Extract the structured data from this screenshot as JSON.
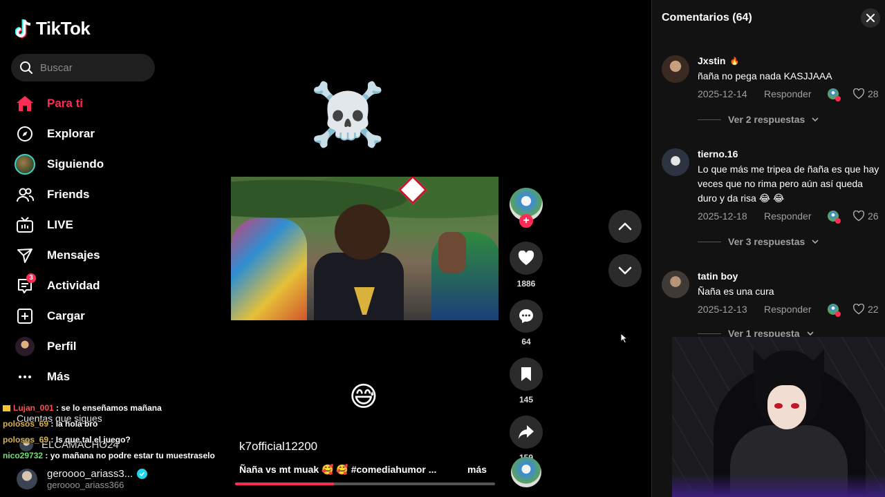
{
  "brand": {
    "name": "TikTok",
    "accent": "#fe2c55"
  },
  "search": {
    "placeholder": "Buscar"
  },
  "nav": [
    {
      "label": "Para ti",
      "icon": "home-icon",
      "active": true
    },
    {
      "label": "Explorar",
      "icon": "compass-icon"
    },
    {
      "label": "Siguiendo",
      "icon": "following-avatar-icon"
    },
    {
      "label": "Friends",
      "icon": "friends-icon"
    },
    {
      "label": "LIVE",
      "icon": "live-tv-icon"
    },
    {
      "label": "Mensajes",
      "icon": "send-icon"
    },
    {
      "label": "Actividad",
      "icon": "activity-icon",
      "badge": "3"
    },
    {
      "label": "Cargar",
      "icon": "upload-icon"
    },
    {
      "label": "Perfil",
      "icon": "profile-avatar-icon"
    },
    {
      "label": "Más",
      "icon": "more-dots-icon"
    }
  ],
  "following": {
    "title": "Cuentas que sigues",
    "items": [
      {
        "name": "ELCAMACHO24"
      },
      {
        "name": "geroooo_ariass3...",
        "handle": "geroooo_ariass366",
        "verified": true
      }
    ]
  },
  "stream_chat": [
    {
      "user": "Lujan_001",
      "text": ": se lo enseñamos mañana",
      "color": "#ff4f4f",
      "crown": true
    },
    {
      "user": "polosos_69",
      "text": ": la hola bro",
      "color": "#d8b24a"
    },
    {
      "user": "polosos_69",
      "text": ": Is que tal el juego?",
      "color": "#d8b24a"
    },
    {
      "user": "nico29732",
      "text": ": yo mañana no podre estar tu muestraselo",
      "color": "#6fe06f"
    }
  ],
  "video": {
    "top_emoji": "☠️",
    "bottom_emoji": "😅",
    "author": "k7official12200",
    "description": "Ñaña vs mt muak 🥰 🥰 #comediahumor ...",
    "more_label": "más",
    "progress": 0.38
  },
  "actions": {
    "likes": "1886",
    "comments": "64",
    "saves": "145",
    "shares": "159"
  },
  "comments_panel": {
    "title": "Comentarios (64)",
    "items": [
      {
        "user": "Jxstin",
        "flame": "🔥",
        "text": "ñaña no pega nada KASJJAAA",
        "date": "2025-12-14",
        "reply_label": "Responder",
        "likes": "28",
        "replies_label": "Ver 2 respuestas"
      },
      {
        "user": "tierno.16",
        "text": "Lo que más me tripea de ñaña es que hay veces que no rima pero aún así queda duro y da risa 😂 😂",
        "date": "2025-12-18",
        "reply_label": "Responder",
        "likes": "26",
        "replies_label": "Ver 3 respuestas"
      },
      {
        "user": "tatin boy",
        "text": "Ñaña es una cura",
        "date": "2025-12-13",
        "reply_label": "Responder",
        "likes": "22",
        "replies_label": "Ver 1 respuesta"
      }
    ]
  }
}
